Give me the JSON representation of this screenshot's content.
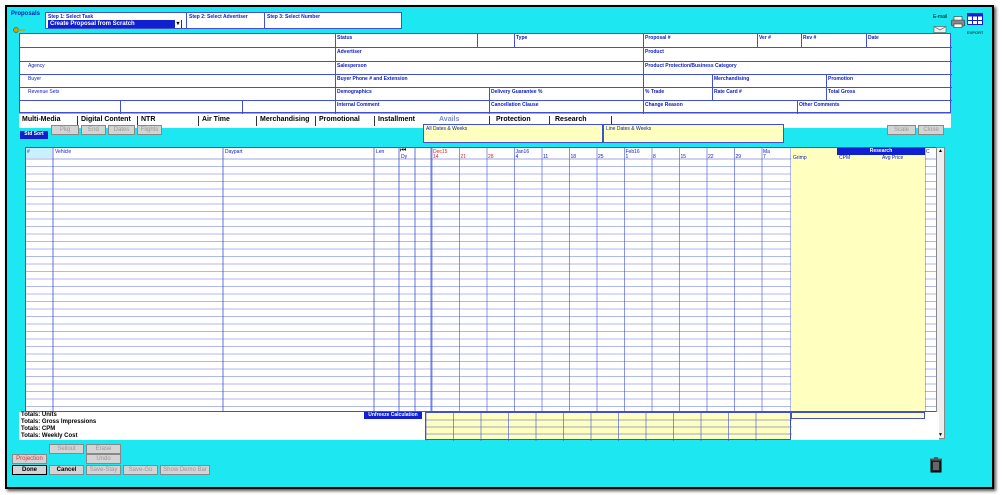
{
  "app": {
    "title": "Proposals"
  },
  "steps": {
    "step1_label": "Step 1: Select Task",
    "step1_value": "Create Proposal from Scratch",
    "step2_label": "Step 2: Select Advertiser",
    "step3_label": "Step 3: Select Number"
  },
  "toolbar": {
    "email_label": "E-mail",
    "export_label": "EXPORT"
  },
  "header_fields": {
    "status": "Status",
    "type": "Type",
    "proposal_no": "Proposal #",
    "ver_no": "Ver #",
    "rev_no": "Rev #",
    "date": "Date",
    "advertiser": "Advertiser",
    "product": "Product",
    "agency": "Agency",
    "salesperson": "Salesperson",
    "product_protection": "Product Protection/Business Category",
    "buyer": "Buyer",
    "buyer_phone": "Buyer Phone # and Extension",
    "merchandising": "Merchandising",
    "promotion": "Promotion",
    "revenue_sets": "Revenue Sets",
    "demographics": "Demographics",
    "delivery_guarantee": "Delivery Guarantee %",
    "pct_trade": "% Trade",
    "rate_card": "Rate Card #",
    "total_gross": "Total Gross",
    "internal_comment": "Internal Comment",
    "cancellation_clause": "Cancellation Clause",
    "change_reason": "Change Reason",
    "other_comments": "Other Comments"
  },
  "tabs": [
    "Multi-Media",
    "Digital Content",
    "NTR",
    "Air Time",
    "Merchandising",
    "Promotional",
    "Installment",
    "Avails",
    "Protection",
    "Research"
  ],
  "grid_toolbar": {
    "std_sort": "Std Sort",
    "pkg": "Pkg",
    "end": "End",
    "dates": "Dates",
    "flights": "Flights",
    "all_dates": "All Dates & Weeks",
    "line_dates": "Line Dates & Weeks",
    "scale": "Scale",
    "close": "Close"
  },
  "grid_headers": {
    "num": "#",
    "vehicle": "Vehicle",
    "daypart": "Daypart",
    "len": "Len",
    "day": "Dy",
    "research": "Research",
    "grimp": "Grimp",
    "cpm": "CPM",
    "avg_price": "Avg Price",
    "c": "C"
  },
  "months": [
    "Dec15",
    "Jan16",
    "Feb16",
    "Ma"
  ],
  "weeks": [
    "14",
    "21",
    "28",
    "4",
    "11",
    "18",
    "25",
    "1",
    "8",
    "15",
    "22",
    "29",
    "7"
  ],
  "totals": {
    "units": "Totals: Units",
    "gross": "Totals: Gross Impressions",
    "cpm": "Totals: CPM",
    "weekly": "Totals: Weekly Cost",
    "unfreeze": "Unfreeze Calculation"
  },
  "bottom_buttons": {
    "sellout": "Sellout",
    "erase": "Erase",
    "projection": "Projection",
    "undo": "Undo",
    "done": "Done",
    "cancel": "Cancel",
    "save_stay": "Save-Stay",
    "save_go": "Save-Go",
    "show_demo_bar": "Show Demo Bar"
  },
  "icons": {
    "key": "key-icon",
    "email": "email-icon",
    "print": "printer-icon",
    "export": "grid-export-icon",
    "trash": "trash-icon"
  },
  "colors": {
    "background": "#1de7f0",
    "accent": "#1020d0",
    "highlight": "#ffffc0"
  }
}
